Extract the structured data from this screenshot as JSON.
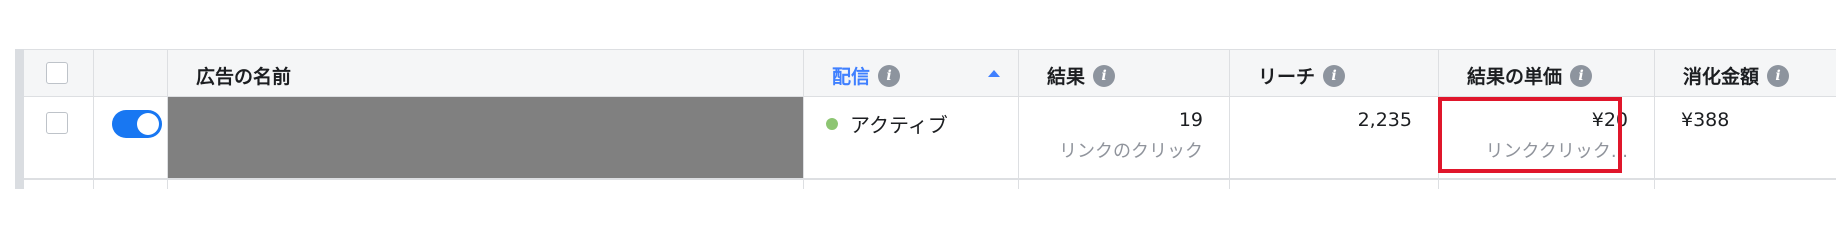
{
  "table": {
    "columns": [
      {
        "key": "checkbox",
        "label": ""
      },
      {
        "key": "toggle",
        "label": ""
      },
      {
        "key": "ad_name",
        "label": "広告の名前"
      },
      {
        "key": "delivery",
        "label": "配信",
        "sorted": "ascending",
        "info": true
      },
      {
        "key": "results",
        "label": "結果",
        "info": true
      },
      {
        "key": "reach",
        "label": "リーチ",
        "info": true
      },
      {
        "key": "cost_per_result",
        "label": "結果の単価",
        "info": true
      },
      {
        "key": "amount_spent",
        "label": "消化金額",
        "info": true
      }
    ],
    "info_glyph": "i",
    "rows": [
      {
        "selected": false,
        "ad_on": true,
        "ad_name": "",
        "delivery_status": "アクティブ",
        "results_value": "19",
        "results_type": "リンクのクリック",
        "reach": "2,235",
        "cost_per_result_value": "¥20",
        "cost_per_result_type": "リンククリック...",
        "amount_spent": "¥388"
      }
    ]
  },
  "colors": {
    "accent_blue": "#4080ff",
    "toggle_on": "#1877f2",
    "active_dot": "#8dc572",
    "highlight_red": "#e0162b",
    "redaction_gray": "#808080"
  }
}
